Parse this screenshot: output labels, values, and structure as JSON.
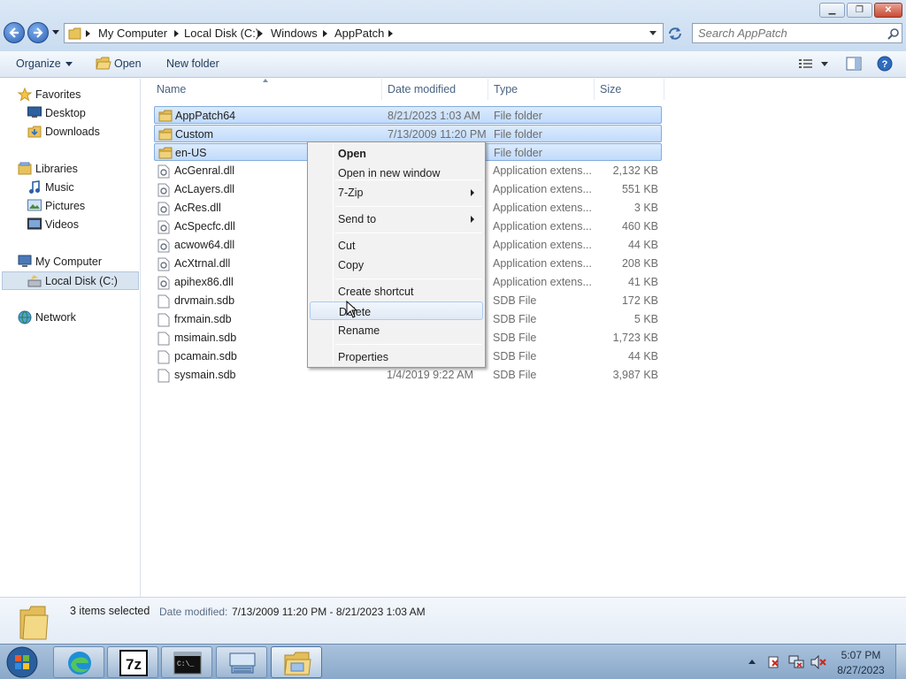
{
  "window": {
    "minimize_label": "▁",
    "maximize_label": "❐",
    "close_label": "✕"
  },
  "address": {
    "crumbs": [
      "My Computer",
      "Local Disk (C:)",
      "Windows",
      "AppPatch"
    ]
  },
  "search": {
    "placeholder": "Search AppPatch"
  },
  "toolbar": {
    "organize": "Organize",
    "open": "Open",
    "new_folder": "New folder"
  },
  "nav": {
    "favorites": "Favorites",
    "desktop": "Desktop",
    "downloads": "Downloads",
    "libraries": "Libraries",
    "music": "Music",
    "pictures": "Pictures",
    "videos": "Videos",
    "my_computer": "My Computer",
    "local_disk": "Local Disk (C:)",
    "network": "Network"
  },
  "columns": {
    "name": "Name",
    "date": "Date modified",
    "type": "Type",
    "size": "Size"
  },
  "files": [
    {
      "name": "AppPatch64",
      "date": "8/21/2023 1:03 AM",
      "type": "File folder",
      "size": "",
      "icon": "folder-icon",
      "selected": true
    },
    {
      "name": "Custom",
      "date": "7/13/2009 11:20 PM",
      "type": "File folder",
      "size": "",
      "icon": "folder-icon",
      "selected": true
    },
    {
      "name": "en-US",
      "date": "",
      "type": "File folder",
      "size": "",
      "icon": "folder-icon",
      "selected": true
    },
    {
      "name": "AcGenral.dll",
      "date": "",
      "type": "Application extens...",
      "size": "2,132 KB",
      "icon": "dll-file-icon",
      "selected": false
    },
    {
      "name": "AcLayers.dll",
      "date": "",
      "type": "Application extens...",
      "size": "551 KB",
      "icon": "dll-file-icon",
      "selected": false
    },
    {
      "name": "AcRes.dll",
      "date": "",
      "type": "Application extens...",
      "size": "3 KB",
      "icon": "dll-file-icon",
      "selected": false
    },
    {
      "name": "AcSpecfc.dll",
      "date": "",
      "type": "Application extens...",
      "size": "460 KB",
      "icon": "dll-file-icon",
      "selected": false
    },
    {
      "name": "acwow64.dll",
      "date": "",
      "type": "Application extens...",
      "size": "44 KB",
      "icon": "dll-file-icon",
      "selected": false
    },
    {
      "name": "AcXtrnal.dll",
      "date": "",
      "type": "Application extens...",
      "size": "208 KB",
      "icon": "dll-file-icon",
      "selected": false
    },
    {
      "name": "apihex86.dll",
      "date": "",
      "type": "Application extens...",
      "size": "41 KB",
      "icon": "dll-file-icon",
      "selected": false
    },
    {
      "name": "drvmain.sdb",
      "date": "",
      "type": "SDB File",
      "size": "172 KB",
      "icon": "sdb-file-icon",
      "selected": false
    },
    {
      "name": "frxmain.sdb",
      "date": "",
      "type": "SDB File",
      "size": "5 KB",
      "icon": "sdb-file-icon",
      "selected": false
    },
    {
      "name": "msimain.sdb",
      "date": "",
      "type": "SDB File",
      "size": "1,723 KB",
      "icon": "sdb-file-icon",
      "selected": false
    },
    {
      "name": "pcamain.sdb",
      "date": "",
      "type": "SDB File",
      "size": "44 KB",
      "icon": "sdb-file-icon",
      "selected": false
    },
    {
      "name": "sysmain.sdb",
      "date": "1/4/2019 9:22 AM",
      "type": "SDB File",
      "size": "3,987 KB",
      "icon": "sdb-file-icon",
      "selected": false
    }
  ],
  "context_menu": [
    {
      "label": "Open",
      "bold": true,
      "submenu": false
    },
    {
      "label": "Open in new window",
      "bold": false,
      "submenu": false
    },
    {
      "label": "7-Zip",
      "bold": false,
      "submenu": true
    },
    {
      "label": "Send to",
      "bold": false,
      "submenu": true
    },
    {
      "label": "Cut",
      "bold": false,
      "submenu": false
    },
    {
      "label": "Copy",
      "bold": false,
      "submenu": false
    },
    {
      "label": "Create shortcut",
      "bold": false,
      "submenu": false
    },
    {
      "label": "Delete",
      "bold": false,
      "submenu": false,
      "hovered": true
    },
    {
      "label": "Rename",
      "bold": false,
      "submenu": false
    },
    {
      "label": "Properties",
      "bold": false,
      "submenu": false
    }
  ],
  "details": {
    "count": "3 items selected",
    "date_label": "Date modified:",
    "date_value": "7/13/2009 11:20 PM - 8/21/2023 1:03 AM"
  },
  "taskbar": {
    "apps": [
      "edge-icon",
      "7zip-icon",
      "cmd-icon",
      "keyboard-icon",
      "explorer-icon"
    ],
    "sevenzip_label": "7z",
    "cmd_label": "C:\\_",
    "time": "5:07 PM",
    "date": "8/27/2023"
  }
}
